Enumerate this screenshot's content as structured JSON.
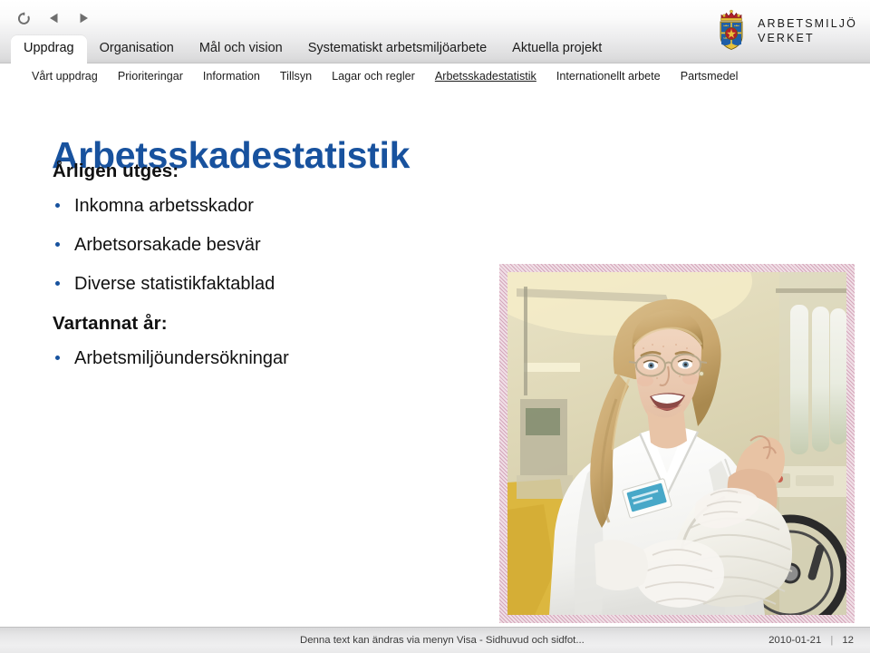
{
  "toolbar": {
    "icons": [
      {
        "name": "refresh-icon",
        "label": "Uppdatera"
      },
      {
        "name": "previous-icon",
        "label": "Föregående"
      },
      {
        "name": "next-icon",
        "label": "Nästa"
      }
    ]
  },
  "header": {
    "tabs": [
      {
        "label": "Uppdrag",
        "active": true
      },
      {
        "label": "Organisation",
        "active": false
      },
      {
        "label": "Mål och vision",
        "active": false
      },
      {
        "label": "Systematiskt arbetsmiljöarbete",
        "active": false
      },
      {
        "label": "Aktuella projekt",
        "active": false
      }
    ],
    "logo": {
      "line1": "ARBETSMILJÖ",
      "line2": "VERKET",
      "crest_name": "swedish-coat-of-arms"
    }
  },
  "subnav": {
    "items": [
      {
        "label": "Vårt uppdrag",
        "active": false
      },
      {
        "label": "Prioriteringar",
        "active": false
      },
      {
        "label": "Information",
        "active": false
      },
      {
        "label": "Tillsyn",
        "active": false
      },
      {
        "label": "Lagar och regler",
        "active": false
      },
      {
        "label": "Arbetsskadestatistik",
        "active": true
      },
      {
        "label": "Internationellt arbete",
        "active": false
      },
      {
        "label": "Partsmedel",
        "active": false
      }
    ]
  },
  "slide": {
    "title": "Arbetsskadestatistik",
    "section_one_heading": "Årligen utges:",
    "section_one_bullets": [
      "Inkomna arbetsskador",
      "Arbetsorsakade besvär",
      "Diverse statistikfaktablad"
    ],
    "section_two_heading": "Vartannat år:",
    "section_two_bullets": [
      "Arbetsmiljöundersökningar"
    ],
    "photo": {
      "alt": "Sjuksköterska i vit uniform som lindar om en fot med bandage",
      "frame_color": "#c484a0"
    }
  },
  "footer": {
    "note": "Denna text kan ändras via menyn Visa - Sidhuvud och sidfot...",
    "date": "2010-01-21",
    "separator": "|",
    "page_number": "12"
  },
  "colors": {
    "title_blue": "#18529E",
    "bullet_blue": "#17529E",
    "header_gray": "#dcdcdd",
    "footer_gray": "#e6e6e7"
  }
}
